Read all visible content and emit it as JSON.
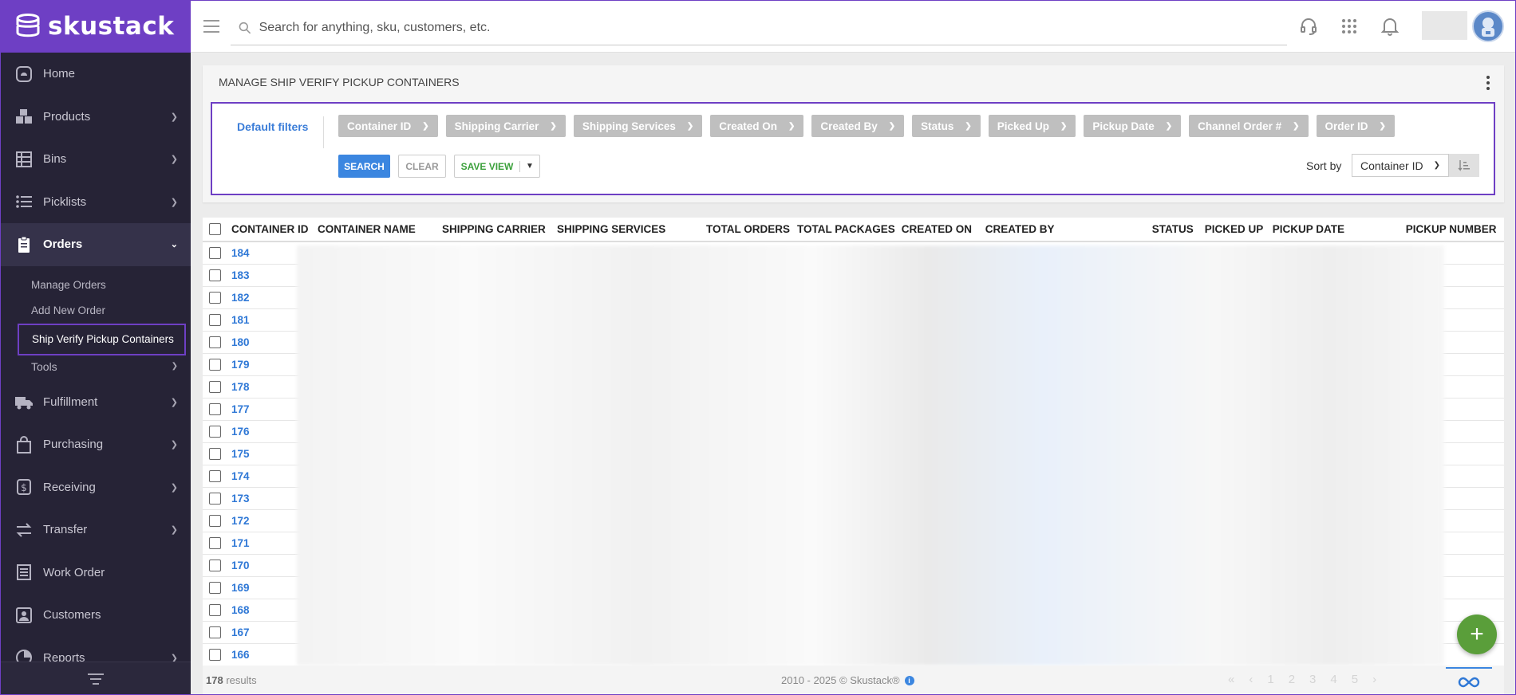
{
  "app": {
    "name": "skustack"
  },
  "sidebar": {
    "items": [
      {
        "label": "Home",
        "icon": "home-icon"
      },
      {
        "label": "Products",
        "icon": "products-icon"
      },
      {
        "label": "Bins",
        "icon": "bins-icon"
      },
      {
        "label": "Picklists",
        "icon": "picklists-icon"
      },
      {
        "label": "Orders",
        "icon": "orders-icon"
      },
      {
        "label": "Fulfillment",
        "icon": "truck-icon"
      },
      {
        "label": "Purchasing",
        "icon": "bag-icon"
      },
      {
        "label": "Receiving",
        "icon": "dollar-icon"
      },
      {
        "label": "Transfer",
        "icon": "transfer-icon"
      },
      {
        "label": "Work Order",
        "icon": "work-order-icon"
      },
      {
        "label": "Customers",
        "icon": "customers-icon"
      },
      {
        "label": "Reports",
        "icon": "reports-icon"
      }
    ],
    "orders_sub": [
      "Manage Orders",
      "Add New Order",
      "Ship Verify Pickup Containers",
      "Tools"
    ]
  },
  "search": {
    "placeholder": "Search for anything, sku, customers, etc."
  },
  "panel": {
    "title": "MANAGE SHIP VERIFY PICKUP CONTAINERS"
  },
  "filters": {
    "default_label": "Default filters",
    "chips": [
      "Container ID",
      "Shipping Carrier",
      "Shipping Services",
      "Created On",
      "Created By",
      "Status",
      "Picked Up",
      "Pickup Date",
      "Channel Order #",
      "Order ID"
    ],
    "search_label": "SEARCH",
    "clear_label": "CLEAR",
    "save_view_label": "SAVE VIEW",
    "sort_label": "Sort by",
    "sort_value": "Container ID"
  },
  "table": {
    "headers": [
      "CONTAINER ID",
      "CONTAINER NAME",
      "SHIPPING CARRIER",
      "SHIPPING SERVICES",
      "TOTAL ORDERS",
      "TOTAL PACKAGES",
      "CREATED ON",
      "CREATED BY",
      "STATUS",
      "PICKED UP",
      "PICKUP DATE",
      "PICKUP NUMBER"
    ],
    "rows": [
      "184",
      "183",
      "182",
      "181",
      "180",
      "179",
      "178",
      "177",
      "176",
      "175",
      "174",
      "173",
      "172",
      "171",
      "170",
      "169",
      "168",
      "167",
      "166"
    ]
  },
  "footer": {
    "results_count": "178",
    "results_label": "results",
    "copyright": "2010 - 2025 © Skustack®",
    "pages": [
      "1",
      "2",
      "3",
      "4",
      "5"
    ]
  },
  "colors": {
    "brand": "#6e3fc4",
    "link": "#2f78d6",
    "fab": "#5a9e3a"
  }
}
